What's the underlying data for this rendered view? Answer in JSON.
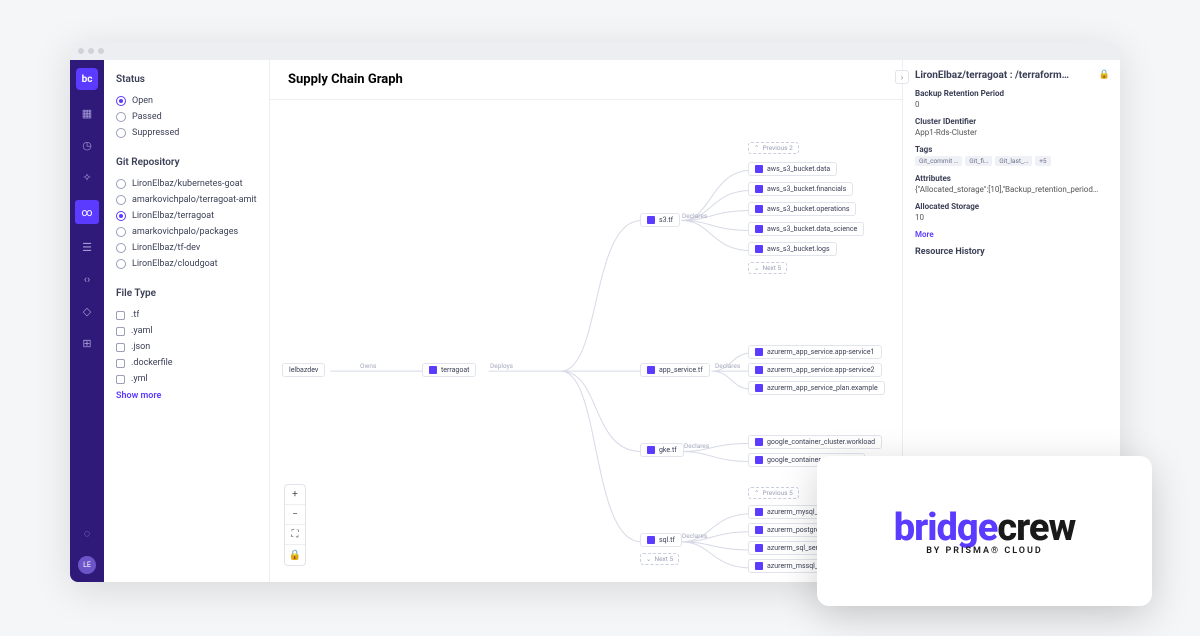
{
  "page_title": "Supply Chain Graph",
  "nav": {
    "logo": "bc",
    "avatar": "LE"
  },
  "sidebar": {
    "status": {
      "title": "Status",
      "options": [
        {
          "label": "Open",
          "selected": true
        },
        {
          "label": "Passed",
          "selected": false
        },
        {
          "label": "Suppressed",
          "selected": false
        }
      ]
    },
    "repos": {
      "title": "Git Repository",
      "options": [
        {
          "label": "LironElbaz/kubernetes-goat",
          "selected": false
        },
        {
          "label": "amarkovichpalo/terragoat-amit",
          "selected": false
        },
        {
          "label": "LironElbaz/terragoat",
          "selected": true
        },
        {
          "label": "amarkovichpalo/packages",
          "selected": false
        },
        {
          "label": "LironElbaz/tf-dev",
          "selected": false
        },
        {
          "label": "LironElbaz/cloudgoat",
          "selected": false
        }
      ]
    },
    "filetype": {
      "title": "File Type",
      "options": [
        {
          "label": ".tf"
        },
        {
          "label": ".yaml"
        },
        {
          "label": ".json"
        },
        {
          "label": ".dockerfile"
        },
        {
          "label": ".yml"
        }
      ],
      "show_more": "Show more"
    }
  },
  "graph": {
    "root_owner": "lelbazdev",
    "edge_owns": "Owns",
    "repo_node": "terragoat",
    "edge_deploys": "Deploys",
    "files": {
      "s3": {
        "name": "s3.tf",
        "edge": "Declares",
        "prev": "Previous 2",
        "next": "Next 5",
        "items": [
          "aws_s3_bucket.data",
          "aws_s3_bucket.financials",
          "aws_s3_bucket.operations",
          "aws_s3_bucket.data_science",
          "aws_s3_bucket.logs"
        ]
      },
      "app": {
        "name": "app_service.tf",
        "edge": "Declares",
        "items": [
          "azurerm_app_service.app-service1",
          "azurerm_app_service.app-service2",
          "azurerm_app_service_plan.example"
        ]
      },
      "gke": {
        "name": "gke.tf",
        "edge": "Declares",
        "items": [
          "google_container_cluster.workload",
          "google_container_node_pool."
        ]
      },
      "sql": {
        "name": "sql.tf",
        "edge": "Declares",
        "prev": "Previous 5",
        "next": "Next 5",
        "items": [
          "azurerm_mysql_server.example",
          "azurerm_postgresql_server.ex",
          "azurerm_sql_server.example",
          "azurerm_mssql_server_secur"
        ]
      }
    }
  },
  "zoom": {
    "in": "+",
    "out": "−",
    "fit": "⛶",
    "lock": "🔒"
  },
  "details": {
    "collapse": "›",
    "title": "LironElbaz/terragoat : /terraform…",
    "lock": "🔒",
    "fields": [
      {
        "label": "Backup Retention Period",
        "value": "0"
      },
      {
        "label": "Cluster IDentifier",
        "value": "App1-Rds-Cluster"
      }
    ],
    "tags_label": "Tags",
    "tags": [
      "Git_commit …",
      "Git_fi…",
      "Git_last_…",
      "+5"
    ],
    "attrs_label": "Attributes",
    "attrs_value": "{\"Allocated_storage\":[10],\"Backup_retention_period…",
    "alloc_label": "Allocated Storage",
    "alloc_value": "10",
    "more": "More",
    "history": "Resource History"
  },
  "brand": {
    "w1": "bridge",
    "w2": "crew",
    "sub": "BY PRISMA® CLOUD"
  }
}
